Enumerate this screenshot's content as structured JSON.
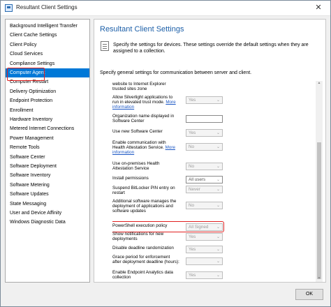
{
  "window": {
    "title": "Resultant Client Settings",
    "close_symbol": "✕"
  },
  "sidebar": {
    "items": [
      {
        "label": "Background Intelligent Transfer"
      },
      {
        "label": "Client Cache Settings"
      },
      {
        "label": "Client Policy"
      },
      {
        "label": "Cloud Services"
      },
      {
        "label": "Compliance Settings"
      },
      {
        "label": "Computer Agent",
        "selected": true
      },
      {
        "label": "Computer Restart"
      },
      {
        "label": "Delivery Optimization"
      },
      {
        "label": "Endpoint Protection"
      },
      {
        "label": "Enrollment"
      },
      {
        "label": "Hardware Inventory"
      },
      {
        "label": "Metered Internet Connections"
      },
      {
        "label": "Power Management"
      },
      {
        "label": "Remote Tools"
      },
      {
        "label": "Software Center"
      },
      {
        "label": "Software Deployment"
      },
      {
        "label": "Software Inventory"
      },
      {
        "label": "Software Metering"
      },
      {
        "label": "Software Updates"
      },
      {
        "label": "State Messaging"
      },
      {
        "label": "User and Device Affinity"
      },
      {
        "label": "Windows Diagnostic Data"
      }
    ]
  },
  "main": {
    "title": "Resultant Client Settings",
    "intro_line1": "Specify the settings for devices. These settings override the default settings when they are",
    "intro_line2": "assigned to a collection.",
    "general": "Specify general settings for communication between server and client."
  },
  "settings": [
    {
      "label": [
        "website to Internet Explorer",
        "trusted sites zone"
      ],
      "control": "none"
    },
    {
      "label": [
        "Allow Silverlight applications to",
        "run in elevated trust mode."
      ],
      "more": "More",
      "label_tail": "information",
      "control": "select",
      "value": "Yes"
    },
    {
      "label": [
        "Organization name displayed in",
        "Software Center"
      ],
      "control": "input",
      "value": ""
    },
    {
      "label": [
        "Use new Software Center"
      ],
      "control": "select",
      "value": "Yes"
    },
    {
      "label": [
        "Enable communication with",
        "Health Attestation Service."
      ],
      "more": "More",
      "label_tail": "information",
      "control": "select",
      "value": "No"
    },
    {
      "label": [
        "Use on-premises Health",
        "Attestation Service"
      ],
      "control": "select",
      "value": "No"
    },
    {
      "label": [
        "Install permissions"
      ],
      "control": "select",
      "value": "All users",
      "enabled": true
    },
    {
      "label": [
        "Suspend BitLocker PIN entry on",
        "restart"
      ],
      "control": "select",
      "value": "Never"
    },
    {
      "label": [
        "Additional software manages the",
        "deployment of applications and",
        "software updates"
      ],
      "control": "select",
      "value": "No"
    },
    {
      "label": [
        "PowerShell execution policy"
      ],
      "control": "select",
      "value": "All Signed",
      "highlighted": true
    },
    {
      "label": [
        "Show notifications for new",
        "deployments"
      ],
      "control": "select",
      "value": "Yes"
    },
    {
      "label": [
        "Disable deadline randomization"
      ],
      "control": "select",
      "value": "Yes"
    },
    {
      "label": [
        "Grace period for enforcement",
        "after deployment deadline (hours):"
      ],
      "control": "select",
      "value": ""
    },
    {
      "label": [
        "Enable Endpoint Analytics data",
        "collection"
      ],
      "control": "select",
      "value": "Yes"
    }
  ],
  "footer": {
    "ok_label": "OK"
  }
}
